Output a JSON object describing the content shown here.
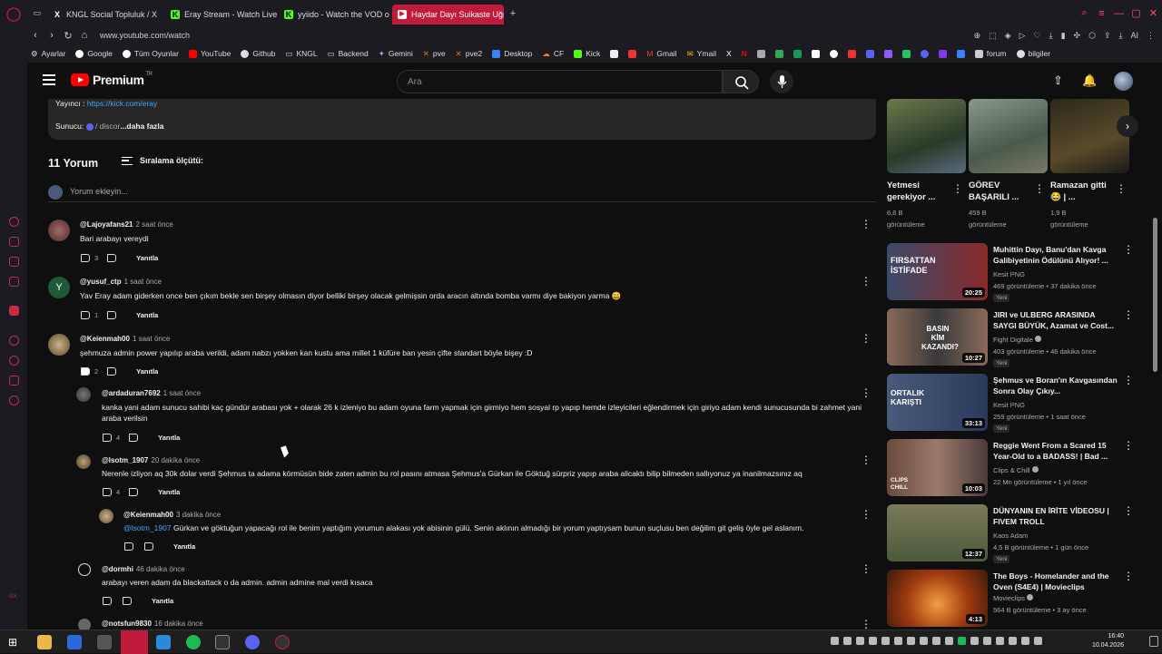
{
  "browser": {
    "tabs": [
      {
        "label": "KNGL Social Topluluk / X",
        "icon": "x-logo-icon",
        "active": false
      },
      {
        "label": "Eray Stream - Watch Live",
        "icon": "kick-logo-icon",
        "active": false
      },
      {
        "label": "yyiido - Watch the VOD o",
        "icon": "kick-logo-icon",
        "active": false
      },
      {
        "label": "Haydar Dayı Suikaste Uğra",
        "icon": "youtube-logo-icon",
        "active": true
      }
    ],
    "new_tab": "+",
    "url": "www.youtube.com/watch",
    "ext_ai": "AI",
    "bookmarks": [
      "Ayarlar",
      "Google",
      "Tüm Oyunlar",
      "YouTube",
      "Github",
      "KNGL",
      "Backend",
      "Gemini",
      "pve",
      "pve2",
      "Desktop",
      "CF",
      "Kick",
      "Gmail",
      "Ymail",
      "forum",
      "bilgiler"
    ]
  },
  "header": {
    "logo": "Premium",
    "logo_sup": "TR",
    "search_placeholder": "Ara"
  },
  "description": {
    "streamer_label": "Yayıncı : ",
    "streamer_link": "https://kick.com/eray",
    "server_label": "Sunucu: ",
    "server_value": "/ discor",
    "more": "...daha fazla"
  },
  "comments_header": {
    "count": "11 Yorum",
    "sort": "Sıralama ölçütü:",
    "add_placeholder": "Yorum ekleyin..."
  },
  "comments": [
    {
      "user": "@Lajoyafans21",
      "time": "2 saat önce",
      "text": "Bari arabayı vereydi",
      "likes": "3",
      "reply": "Yanıtla"
    },
    {
      "user": "@yusuf_ctp",
      "time": "1 saat önce",
      "text": "Yav Eray adam giderken once ben çıkım bekle sen birşey olmasın diyor belliki birşey olacak gelmişsin  orda aracın altında bomba varmı diye bakiyon yarma  😀",
      "likes": "1",
      "reply": "Yanıtla",
      "avatar_letter": "Y"
    },
    {
      "user": "@Keienmah00",
      "time": "1 saat önce",
      "text": "şehmuza admin power yapılıp araba verildi, adam nabzı yokken kan kustu ama millet 1 küfüre ban yesin çifte standart böyle bişey :D",
      "likes": "2",
      "reply": "Yanıtla"
    },
    {
      "user": "@ardaduran7692",
      "time": "1 saat önce",
      "text": "kanka yani adam sunucu sahibi kaç gündür arabası yok + olarak 26 k izleniyo bu adam oyuna farm yapmak için girmiyo hem sosyal rp yapıp hemde izleyicileri eğlendirmek için giriyo adam kendi sunucusunda bi zahmet yani araba verilsin",
      "likes": "4",
      "reply": "Yanıtla"
    },
    {
      "user": "@lsotm_1907",
      "time": "20 dakika önce",
      "text": "Nerenle izliyon aq 30k dolar verdi Şehmus ta adama körmüsün bide zaten admin bu rol pasını atmasa Şehmus'a Gürkan ile Göktuğ sürpriz yapıp araba alicaktı bilip bilmeden sallıyonuz ya inanilmazsınız aq",
      "likes": "4",
      "reply": "Yanıtla"
    },
    {
      "user": "@Keienmah00",
      "time": "3 dakika önce",
      "mention": "@lsotm_1907",
      "text": " Gürkan ve göktuğun yapacağı rol ile benim yaptığım yorumun alakası yok abisinin gülü. Senin aklının almadığı bir yorum yaptıysam bunun suçlusu ben değilim git geliş öyle gel aslanım.",
      "likes": "",
      "reply": "Yanıtla"
    },
    {
      "user": "@dormhi",
      "time": "46 dakika önce",
      "text": "arabayı veren adam da blackattack o da admin. admin admine mal verdi kısaca",
      "likes": "",
      "reply": "Yanıtla"
    },
    {
      "user": "@notsfun9830",
      "time": "16 dakika önce",
      "text": "",
      "likes": "",
      "reply": ""
    }
  ],
  "top_videos": [
    {
      "title": "Yetmesi gerekiyor ...",
      "views": "6,6 B",
      "views_label": "görüntüleme"
    },
    {
      "title": "GÖREV BAŞARILI ...",
      "views": "459 B",
      "views_label": "görüntüleme"
    },
    {
      "title": "Ramazan gitti 😂 | ...",
      "views": "1,9 B",
      "views_label": "görüntüleme"
    }
  ],
  "recommendations": [
    {
      "title": "Muhittin Dayı, Banu'dan Kavga Galibiyetinin Ödülünü Alıyor! ...",
      "channel": "Kesit PNG",
      "meta": "469 görüntüleme • 37 dakika önce",
      "badge": "Yeni",
      "duration": "20:25",
      "thumb_text": "FIRSATTAN İSTİFADE"
    },
    {
      "title": "JIRI ve ULBERG ARASINDA SAYGI BÜYÜK, Azamat ve Cost...",
      "channel": "Fight Digitale",
      "meta": "403 görüntüleme • 46 dakika önce",
      "badge": "Yeni",
      "duration": "10:27",
      "thumb_text": "BASIN KİM KAZANDI?"
    },
    {
      "title": "Şehmus ve Boran'ın Kavgasından Sonra Olay Çıkıy...",
      "channel": "Kesit PNG",
      "meta": "259 görüntüleme • 1 saat önce",
      "badge": "Yeni",
      "duration": "33:13",
      "thumb_text": "ORTALIK KARIŞTI"
    },
    {
      "title": "Reggie Went From a Scared 15 Year-Old to a BADASS! | Bad ...",
      "channel": "Clips & Chill",
      "meta": "22 Mn görüntüleme • 1 yıl önce",
      "badge": "",
      "duration": "10:03",
      "thumb_text": "CLIPS CHILL"
    },
    {
      "title": "DÜNYANIN EN İRİTE VİDEOSU | FIVEM TROLL",
      "channel": "Kaos Adam",
      "meta": "4,5 B görüntüleme • 1 gün önce",
      "badge": "Yeni",
      "duration": "12:37",
      "thumb_text": ""
    },
    {
      "title": "The Boys - Homelander and the Oven (S4E4) | Movieclips",
      "channel": "Movieclips",
      "meta": "564 B görüntüleme • 3 ay önce",
      "badge": "",
      "duration": "4:13",
      "thumb_text": ""
    }
  ],
  "taskbar": {
    "time": "16:40",
    "date": "10.04.2026"
  }
}
